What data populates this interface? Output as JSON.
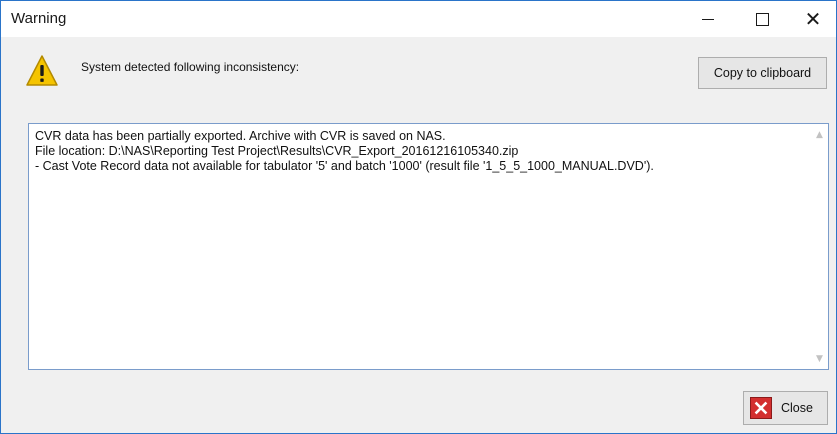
{
  "window": {
    "title": "Warning"
  },
  "dialog": {
    "message": "System detected following inconsistency:",
    "copy_button_label": "Copy to clipboard",
    "close_button_label": "Close",
    "details_lines": [
      "CVR data has been partially exported. Archive with CVR is saved on NAS.",
      "File location: D:\\NAS\\Reporting Test Project\\Results\\CVR_Export_20161216105340.zip",
      "- Cast Vote Record data not available for tabulator '5' and batch '1000' (result file '1_5_5_1000_MANUAL.DVD')."
    ]
  },
  "icons": {
    "warning": "warning-icon",
    "close_button_icon": "close-x-icon",
    "minimize": "minimize-icon",
    "maximize": "maximize-icon",
    "close": "close-icon"
  },
  "colors": {
    "accent_border": "#2a74c9",
    "warning_yellow": "#f5c400",
    "close_red": "#d32f2f"
  }
}
